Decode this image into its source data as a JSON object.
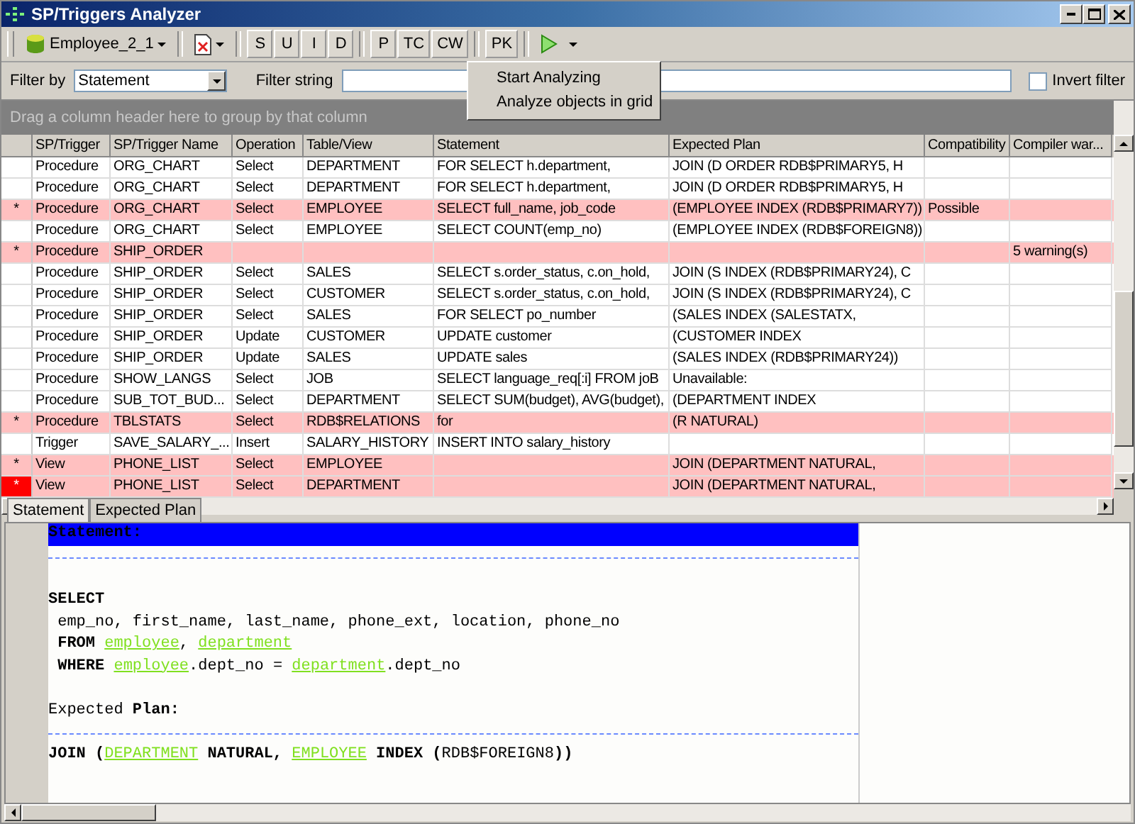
{
  "window": {
    "title": "SP/Triggers Analyzer"
  },
  "toolbar": {
    "database": "Employee_2_1",
    "groups": [
      [
        "S",
        "U",
        "I",
        "D"
      ],
      [
        "P",
        "TC",
        "CW"
      ],
      [
        "PK"
      ]
    ]
  },
  "run_menu": {
    "items": [
      "Start Analyzing",
      "Analyze objects in grid"
    ]
  },
  "filter": {
    "label": "Filter by",
    "value": "Statement",
    "string_label": "Filter string",
    "invert": {
      "label": "Invert filter",
      "checked": false
    }
  },
  "group_panel": "Drag a column header here to group by that column",
  "grid": {
    "columns": [
      "SP/Trigger",
      "SP/Trigger Name",
      "Operation",
      "Table/View",
      "Statement",
      "Expected Plan",
      "Compatibility",
      "Compiler war..."
    ],
    "rows": [
      {
        "flagged": false,
        "selected": false,
        "cells": [
          "Procedure",
          "ORG_CHART",
          "Select",
          "DEPARTMENT",
          "FOR SELECT h.department,",
          "JOIN (D ORDER RDB$PRIMARY5, H",
          "",
          ""
        ]
      },
      {
        "flagged": false,
        "selected": false,
        "cells": [
          "Procedure",
          "ORG_CHART",
          "Select",
          "DEPARTMENT",
          "FOR SELECT h.department,",
          "JOIN (D ORDER RDB$PRIMARY5, H",
          "",
          ""
        ]
      },
      {
        "marker": "*",
        "flagged": true,
        "selected": false,
        "cells": [
          "Procedure",
          "ORG_CHART",
          "Select",
          "EMPLOYEE",
          "SELECT full_name, job_code",
          "(EMPLOYEE INDEX (RDB$PRIMARY7))",
          "Possible",
          ""
        ]
      },
      {
        "flagged": false,
        "selected": false,
        "cells": [
          "Procedure",
          "ORG_CHART",
          "Select",
          "EMPLOYEE",
          "SELECT COUNT(emp_no)",
          "(EMPLOYEE INDEX (RDB$FOREIGN8))",
          "",
          ""
        ]
      },
      {
        "marker": "*",
        "flagged": true,
        "selected": false,
        "cells": [
          "Procedure",
          "SHIP_ORDER",
          "",
          "",
          "",
          "",
          "",
          "5 warning(s)"
        ]
      },
      {
        "flagged": false,
        "selected": false,
        "cells": [
          "Procedure",
          "SHIP_ORDER",
          "Select",
          "SALES",
          "SELECT s.order_status, c.on_hold,",
          "JOIN (S INDEX (RDB$PRIMARY24), C",
          "",
          ""
        ]
      },
      {
        "flagged": false,
        "selected": false,
        "cells": [
          "Procedure",
          "SHIP_ORDER",
          "Select",
          "CUSTOMER",
          "SELECT s.order_status, c.on_hold,",
          "JOIN (S INDEX (RDB$PRIMARY24), C",
          "",
          ""
        ]
      },
      {
        "flagged": false,
        "selected": false,
        "cells": [
          "Procedure",
          "SHIP_ORDER",
          "Select",
          "SALES",
          "FOR SELECT po_number",
          "(SALES INDEX (SALESTATX,",
          "",
          ""
        ]
      },
      {
        "flagged": false,
        "selected": false,
        "cells": [
          "Procedure",
          "SHIP_ORDER",
          "Update",
          "CUSTOMER",
          "UPDATE customer",
          "(CUSTOMER INDEX",
          "",
          ""
        ]
      },
      {
        "flagged": false,
        "selected": false,
        "cells": [
          "Procedure",
          "SHIP_ORDER",
          "Update",
          "SALES",
          "UPDATE sales",
          "(SALES INDEX (RDB$PRIMARY24))",
          "",
          ""
        ]
      },
      {
        "flagged": false,
        "selected": false,
        "cells": [
          "Procedure",
          "SHOW_LANGS",
          "Select",
          "JOB",
          "SELECT language_req[:i] FROM joB",
          "Unavailable:",
          "",
          ""
        ]
      },
      {
        "flagged": false,
        "selected": false,
        "cells": [
          "Procedure",
          "SUB_TOT_BUD...",
          "Select",
          "DEPARTMENT",
          "SELECT SUM(budget), AVG(budget),",
          "(DEPARTMENT INDEX",
          "",
          ""
        ]
      },
      {
        "marker": "*",
        "flagged": true,
        "selected": false,
        "cells": [
          "Procedure",
          "TBLSTATS",
          "Select",
          "RDB$RELATIONS",
          "for",
          "(R NATURAL)",
          "",
          ""
        ]
      },
      {
        "flagged": false,
        "selected": false,
        "cells": [
          "Trigger",
          "SAVE_SALARY_...",
          "Insert",
          "SALARY_HISTORY",
          " INSERT INTO salary_history",
          "",
          "",
          ""
        ]
      },
      {
        "marker": "*",
        "flagged": true,
        "selected": false,
        "cells": [
          "View",
          "PHONE_LIST",
          "Select",
          "EMPLOYEE",
          "",
          "JOIN (DEPARTMENT NATURAL,",
          "",
          ""
        ]
      },
      {
        "marker": "*",
        "flagged": true,
        "selected": true,
        "cells": [
          "View",
          "PHONE_LIST",
          "Select",
          "DEPARTMENT",
          "",
          "JOIN (DEPARTMENT NATURAL,",
          "",
          ""
        ]
      }
    ]
  },
  "tabs": [
    {
      "label": "Statement",
      "selected": true
    },
    {
      "label": "Expected Plan",
      "selected": false
    }
  ],
  "editor": {
    "lines": [
      {
        "kind": "heading",
        "segments": [
          {
            "kind": "keyword",
            "text": "Statement:"
          }
        ]
      },
      {
        "kind": "rule"
      },
      {
        "kind": "blank"
      },
      {
        "kind": "code",
        "segments": [
          {
            "kind": "keyword",
            "text": "SELECT"
          }
        ]
      },
      {
        "kind": "code",
        "segments": [
          {
            "kind": "plain",
            "text": " emp_no, first_name, last_name, phone_ext, location, phone_no"
          }
        ]
      },
      {
        "kind": "code",
        "segments": [
          {
            "kind": "keyword",
            "text": " FROM "
          },
          {
            "kind": "table",
            "text": "employee"
          },
          {
            "kind": "plain",
            "text": ", "
          },
          {
            "kind": "table",
            "text": "department"
          }
        ]
      },
      {
        "kind": "code",
        "segments": [
          {
            "kind": "keyword",
            "text": " WHERE "
          },
          {
            "kind": "table",
            "text": "employee"
          },
          {
            "kind": "plain",
            "text": ".dept_no = "
          },
          {
            "kind": "table",
            "text": "department"
          },
          {
            "kind": "plain",
            "text": ".dept_no"
          }
        ]
      },
      {
        "kind": "blank"
      },
      {
        "kind": "code",
        "segments": [
          {
            "kind": "plain",
            "text": "Expected "
          },
          {
            "kind": "keyword",
            "text": "Plan:"
          }
        ]
      },
      {
        "kind": "rule"
      },
      {
        "kind": "code",
        "segments": [
          {
            "kind": "keyword",
            "text": "JOIN ("
          },
          {
            "kind": "table",
            "text": "DEPARTMENT"
          },
          {
            "kind": "keyword",
            "text": " NATURAL, "
          },
          {
            "kind": "table",
            "text": "EMPLOYEE"
          },
          {
            "kind": "keyword",
            "text": " INDEX ("
          },
          {
            "kind": "plain",
            "text": "RDB$FOREIGN8"
          },
          {
            "kind": "keyword",
            "text": "))"
          }
        ]
      }
    ]
  }
}
